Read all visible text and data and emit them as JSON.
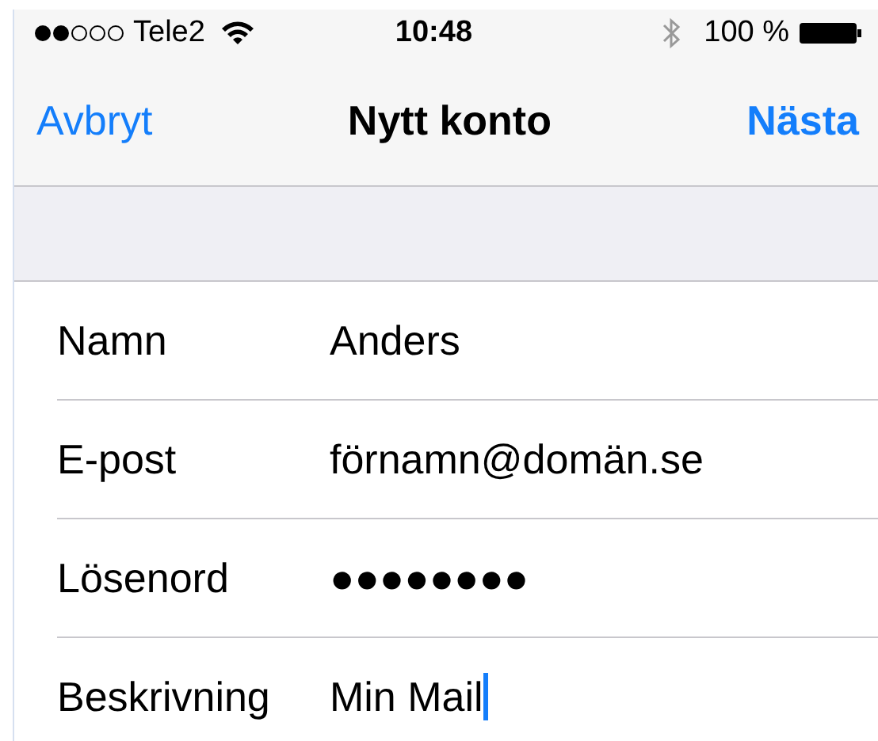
{
  "status_bar": {
    "carrier": "Tele2",
    "time": "10:48",
    "battery": "100 %"
  },
  "nav_bar": {
    "cancel": "Avbryt",
    "title": "Nytt konto",
    "next": "Nästa"
  },
  "fields": [
    {
      "label": "Namn",
      "value": "Anders",
      "focused": false
    },
    {
      "label": "E-post",
      "value": "förnamn@domän.se",
      "focused": false
    },
    {
      "label": "Lösenord",
      "value": "●●●●●●●●",
      "focused": false
    },
    {
      "label": "Beskrivning",
      "value": "Min Mail",
      "focused": true
    }
  ]
}
